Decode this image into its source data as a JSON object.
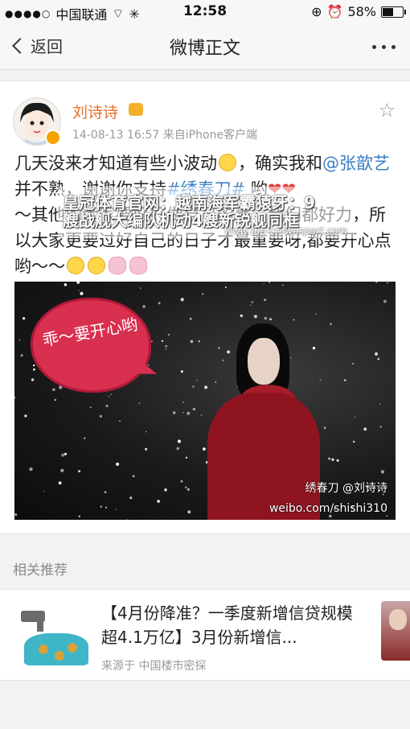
{
  "status_bar": {
    "carrier": "中国联通",
    "time": "12:58",
    "battery": "58%",
    "battery_level": 0.58
  },
  "nav": {
    "back_label": "返回",
    "title": "微博正文"
  },
  "post": {
    "user_name": "刘诗诗",
    "timestamp": "14-08-13 16:57",
    "source": "来自iPhone客户端",
    "text_1": "几天没来才知道有些小波动",
    "text_2": "，确实我和",
    "mention": "@张歆艺",
    "text_3": " 并不熟，谢谢你支持",
    "topic": "#绣春刀#",
    "text_4": " 哟",
    "text_5": "～其他的大家要好好做自己的事，我们都好力，所以大家更要过好自己的日子才最重要呀,都要开心点哟～～"
  },
  "overlay": {
    "line1": "皇冠体育官网：越南海军霸猿牙：9",
    "line2": "艘战舰大编队机动4艘新锐舰同框",
    "url": "www.fun-crownsport.com"
  },
  "photo": {
    "bubble_text": "乖～要开心哟",
    "signature": "绣春刀 @刘诗诗",
    "watermark": "weibo.com/shishi310"
  },
  "related": {
    "section_title": "相关推荐",
    "headline": "【4月份降准？一季度新增信贷规模超4.1万亿】3月份新增信...",
    "source": "来源于 中国楼市密探"
  }
}
